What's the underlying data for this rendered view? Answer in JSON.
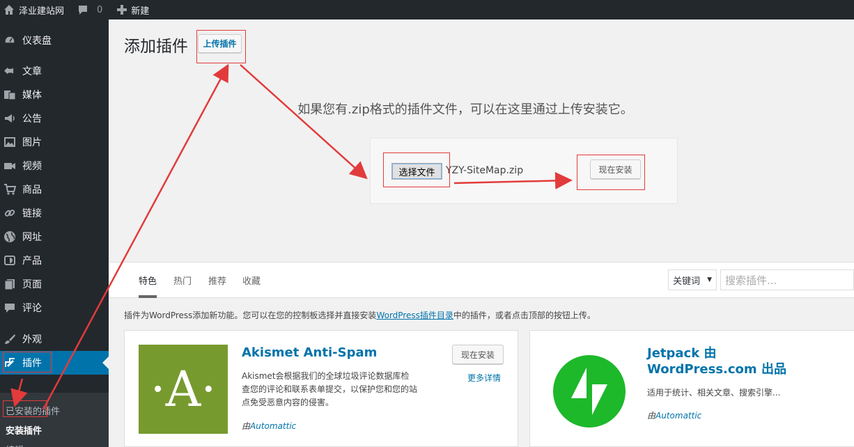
{
  "adminbar": {
    "site_name": "泽业建站网",
    "comments_count": "0",
    "new_label": "新建"
  },
  "sidebar": {
    "items": [
      {
        "label": "仪表盘"
      },
      {
        "label": "文章"
      },
      {
        "label": "媒体"
      },
      {
        "label": "公告"
      },
      {
        "label": "图片"
      },
      {
        "label": "视频"
      },
      {
        "label": "商品"
      },
      {
        "label": "链接"
      },
      {
        "label": "网址"
      },
      {
        "label": "产品"
      },
      {
        "label": "页面"
      },
      {
        "label": "评论"
      },
      {
        "label": "外观"
      },
      {
        "label": "插件"
      }
    ],
    "submenu": [
      {
        "label": "已安装的插件"
      },
      {
        "label": "安装插件"
      },
      {
        "label": "编辑"
      }
    ]
  },
  "page": {
    "title": "添加插件",
    "upload_button": "上传插件",
    "upload_desc": "如果您有.zip格式的插件文件，可以在这里通过上传安装它。",
    "choose_file": "选择文件",
    "file_name": "YZY-SiteMap.zip",
    "install_now": "现在安装"
  },
  "filter": {
    "tabs": [
      {
        "label": "特色"
      },
      {
        "label": "热门"
      },
      {
        "label": "推荐"
      },
      {
        "label": "收藏"
      }
    ],
    "keyword_select": "关键词",
    "search_placeholder": "搜索插件..."
  },
  "intro": {
    "before": "插件为WordPress添加新功能。您可以在您的控制板选择并直接安装",
    "link": "WordPress插件目录",
    "after": "中的插件，或者点击顶部的按钮上传。"
  },
  "plugins": [
    {
      "name": "Akismet Anti-Spam",
      "desc": "Akismet会根据我们的全球垃圾评论数据库检查您的评论和联系表单提交，以保护您和您的站点免受恶意内容的侵害。",
      "by": "由",
      "author": "Automattic",
      "install": "现在安装",
      "more": "更多详情",
      "icon_letter": "·A·",
      "icon_color": "#779a2f"
    },
    {
      "name": "Jetpack 由 WordPress.com 出品",
      "desc": "适用于统计、相关文章、搜索引擎...",
      "by": "由",
      "author": "Automattic",
      "icon_color": "#1eb82b"
    }
  ],
  "colors": {
    "adminbar": "#23282d",
    "accent": "#0073aa",
    "annotation": "#e23b3b"
  }
}
